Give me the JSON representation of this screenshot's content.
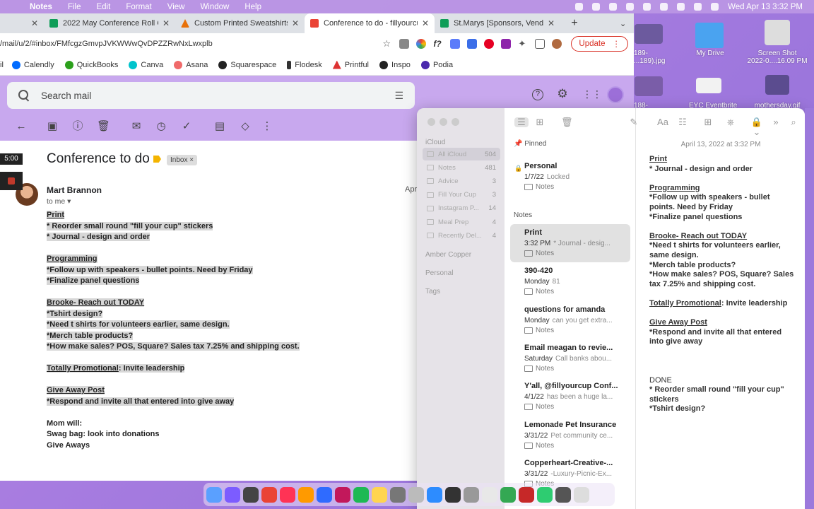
{
  "menubar": {
    "app": "Notes",
    "items": [
      "File",
      "Edit",
      "Format",
      "View",
      "Window",
      "Help"
    ],
    "datetime": "Wed Apr 13  3:32 PM"
  },
  "browser": {
    "tabs": [
      {
        "title": "2022 May Conference Roll Ca",
        "favicon_color": "#0f9d58"
      },
      {
        "title": "Custom Printed Sweatshirts",
        "favicon_color": "#e8710a"
      },
      {
        "title": "Conference to do - fillyourcup",
        "favicon_color": "#ea4335"
      },
      {
        "title": "St.Marys [Sponsors, Vendors",
        "favicon_color": "#0f9d58"
      }
    ],
    "url": "/mail/u/2/#inbox/FMfcgzGmvpJVKWWwQvDPZZRwNxLwxplb",
    "update_label": "Update",
    "bookmarks": [
      {
        "label": "Calendly",
        "color": "#006bff"
      },
      {
        "label": "QuickBooks",
        "color": "#2ca01c"
      },
      {
        "label": "Canva",
        "color": "#00c4cc"
      },
      {
        "label": "Asana",
        "color": "#f06a6a"
      },
      {
        "label": "Squarespace",
        "color": "#222222"
      },
      {
        "label": "Flodesk",
        "color": "#333333"
      },
      {
        "label": "Printful",
        "color": "#d33"
      },
      {
        "label": "Inspo",
        "color": "#222222"
      },
      {
        "label": "Podia",
        "color": "#4b2aad"
      }
    ]
  },
  "gmail": {
    "search_placeholder": "Search mail",
    "subject": "Conference to do",
    "label_chip": "Inbox ×",
    "sender": "Mart Brannon",
    "to": "to me ▾",
    "date_partial": "Apr",
    "timer": "5:00",
    "body": [
      {
        "text": "Print",
        "u": true,
        "hl": true
      },
      {
        "text": "* Reorder small round \"fill your cup\" stickers",
        "hl": true
      },
      {
        "text": "* Journal - design and order",
        "hl": true
      },
      {
        "text": ""
      },
      {
        "text": "Programming",
        "u": true,
        "hl": true
      },
      {
        "text": "*Follow up with speakers - bullet points. Need by Friday",
        "hl": true
      },
      {
        "text": "*Finalize panel questions",
        "hl": true
      },
      {
        "text": ""
      },
      {
        "text": "Brooke- Reach out TODAY",
        "u": true,
        "hl": true
      },
      {
        "text": "*Tshirt design?",
        "hl": true
      },
      {
        "text": "*Need t shirts for volunteers earlier, same design.",
        "hl": true
      },
      {
        "text": "*Merch table products?",
        "hl": true
      },
      {
        "text": "*How make sales? POS, Square? Sales tax 7.25% and shipping cost.",
        "hl": true
      },
      {
        "text": ""
      },
      {
        "text": "Totally Promotional: Invite leadership",
        "hl": true,
        "u_prefix": "Totally Promotional"
      },
      {
        "text": ""
      },
      {
        "text": "Give Away Post",
        "u": true,
        "hl": true
      },
      {
        "text": "*Respond and invite all that entered into give away",
        "hl": true
      },
      {
        "text": ""
      },
      {
        "text": "Mom will:"
      },
      {
        "text": "Swag bag: look into donations"
      },
      {
        "text": "Give Aways"
      }
    ]
  },
  "desktop": {
    "icons": [
      {
        "label": "189-\n...189).jpg"
      },
      {
        "label": "My Drive"
      },
      {
        "label": "Screen Shot\n2022-0....16.09 PM"
      },
      {
        "label": "188-"
      },
      {
        "label": "EYC Eventbrite"
      },
      {
        "label": "mothersday.gif"
      }
    ]
  },
  "notes": {
    "sidebar_header": "iCloud",
    "folders": [
      {
        "name": "All iCloud",
        "count": "504",
        "selected": true
      },
      {
        "name": "Notes",
        "count": "481"
      },
      {
        "name": "Advice",
        "count": "3"
      },
      {
        "name": "Fill Your Cup",
        "count": "3"
      },
      {
        "name": "Instagram P...",
        "count": "14"
      },
      {
        "name": "Meal Prep",
        "count": "4"
      },
      {
        "name": "Recently Del...",
        "count": "4"
      }
    ],
    "accounts": [
      "Amber Copper",
      "Personal",
      "Tags"
    ],
    "pinned_header": "Pinned",
    "pinned": {
      "title": "Personal",
      "date": "1/7/22",
      "preview": "Locked",
      "folder": "Notes"
    },
    "notes_header": "Notes",
    "items": [
      {
        "title": "Print",
        "date": "3:32 PM",
        "preview": "* Journal - desig...",
        "folder": "Notes",
        "selected": true
      },
      {
        "title": "390-420",
        "date": "Monday",
        "preview": "81",
        "folder": "Notes"
      },
      {
        "title": "questions for amanda",
        "date": "Monday",
        "preview": "can you get extra...",
        "folder": "Notes"
      },
      {
        "title": "Email meagan to revie...",
        "date": "Saturday",
        "preview": "Call banks abou...",
        "folder": "Notes"
      },
      {
        "title": "Y'all, @fillyourcup Conf...",
        "date": "4/1/22",
        "preview": "has been a huge la...",
        "folder": "Notes"
      },
      {
        "title": "Lemonade Pet Insurance",
        "date": "3/31/22",
        "preview": "Pet community ce...",
        "folder": "Notes"
      },
      {
        "title": "Copperheart-Creative-...",
        "date": "3/31/22",
        "preview": "-Luxury-Picnic-Ex...",
        "folder": "Notes"
      }
    ],
    "editor_date": "April 13, 2022 at 3:32 PM",
    "editor_lines": [
      {
        "text": "Print",
        "u": true
      },
      {
        "text": "* Journal - design and order"
      },
      {
        "text": ""
      },
      {
        "text": "Programming",
        "u": true
      },
      {
        "text": "*Follow up with speakers - bullet"
      },
      {
        "text": "points. Need by Friday"
      },
      {
        "text": "*Finalize panel questions"
      },
      {
        "text": ""
      },
      {
        "text": "Brooke- Reach out TODAY",
        "u": true
      },
      {
        "text": "*Need t shirts for volunteers earlier,"
      },
      {
        "text": "same design."
      },
      {
        "text": "*Merch table products?"
      },
      {
        "text": "*How make sales? POS, Square? Sales"
      },
      {
        "text": "tax 7.25% and shipping cost."
      },
      {
        "text": ""
      },
      {
        "text": "Totally Promotional: Invite leadership",
        "u_prefix": "Totally Promotional"
      },
      {
        "text": ""
      },
      {
        "text": "Give Away Post",
        "u": true
      },
      {
        "text": "*Respond and invite all that entered"
      },
      {
        "text": "into give away"
      },
      {
        "text": ""
      },
      {
        "text": ""
      },
      {
        "text": ""
      },
      {
        "text": "DONE",
        "normal": true
      },
      {
        "text": "* Reorder small round \"fill your cup\""
      },
      {
        "text": "stickers"
      },
      {
        "text": "*Tshirt design?"
      }
    ]
  },
  "dock": {
    "apps": [
      "#5aa0ff",
      "#7c5cff",
      "#444",
      "#ea4335",
      "#ff3355",
      "#ff9a00",
      "#2f6bff",
      "#c2185b",
      "#1db954",
      "#ffd54f",
      "#777",
      "#bbb",
      "#2d8cff",
      "#333",
      "#999",
      "#e8e8e8",
      "#34a853",
      "#c62828",
      "#2ecc71",
      "#555",
      "#ddd"
    ]
  }
}
